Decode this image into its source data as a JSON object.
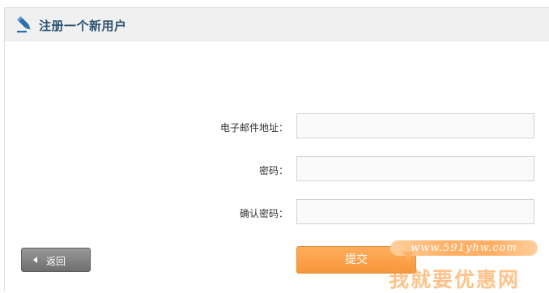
{
  "header": {
    "title": "注册一个新用户",
    "icon": "pencil-icon"
  },
  "form": {
    "email_label": "电子邮件地址：",
    "password_label": "密码：",
    "confirm_label": "确认密码：",
    "email_value": "",
    "password_value": "",
    "confirm_value": ""
  },
  "actions": {
    "back_label": "返回",
    "submit_label": "提交"
  },
  "watermark": {
    "url": "www.591yhw.com",
    "text": "我就要优惠网"
  },
  "colors": {
    "header_bg": "#f0f0f0",
    "title": "#2c5270",
    "accent": "#f7963c",
    "back_button": "#7a7a7a"
  }
}
